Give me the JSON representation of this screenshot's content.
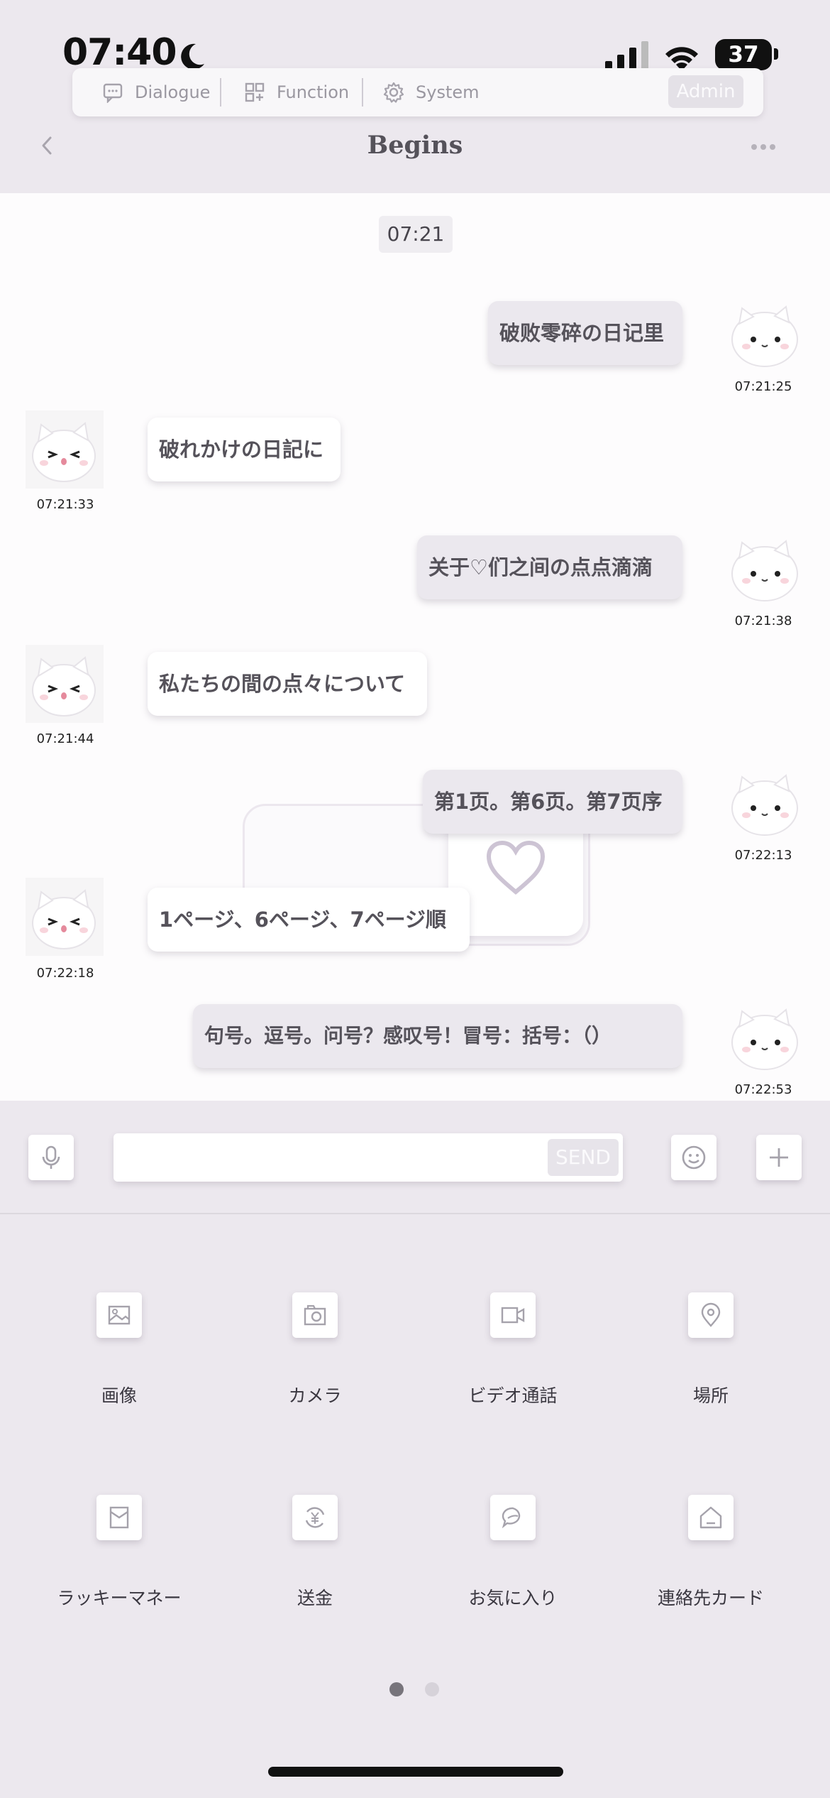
{
  "status_bar": {
    "time": "07:40",
    "battery": "37"
  },
  "menu": {
    "dialogue": "Dialogue",
    "function": "Function",
    "system": "System",
    "admin": "Admin"
  },
  "header": {
    "title": "Begins"
  },
  "chat": {
    "time_divider": "07:21",
    "messages": [
      {
        "side": "sent",
        "text": "破败零碎の日记里",
        "time": "07:21:25"
      },
      {
        "side": "recv",
        "text": "破れかけの日記に",
        "time": "07:21:33"
      },
      {
        "side": "sent",
        "text": "关于♡们之间の点点滴滴",
        "time": "07:21:38"
      },
      {
        "side": "recv",
        "text": "私たちの間の点々について",
        "time": "07:21:44"
      },
      {
        "side": "sent",
        "text": "第1页。第6页。第7页序",
        "time": "07:22:13"
      },
      {
        "side": "recv",
        "text": "1ページ、6ページ、7ページ順",
        "time": "07:22:18"
      },
      {
        "side": "sent",
        "text": "句号。逗号。问号？感叹号！冒号：括号：（）",
        "time": "07:22:53"
      }
    ]
  },
  "input": {
    "placeholder": "",
    "send": "SEND"
  },
  "functions": [
    {
      "label": "画像",
      "icon": "image-icon"
    },
    {
      "label": "カメラ",
      "icon": "camera-icon"
    },
    {
      "label": "ビデオ通話",
      "icon": "video-call-icon"
    },
    {
      "label": "場所",
      "icon": "location-pin-icon"
    },
    {
      "label": "ラッキーマネー",
      "icon": "red-envelope-icon"
    },
    {
      "label": "送金",
      "icon": "yen-transfer-icon"
    },
    {
      "label": "お気に入り",
      "icon": "favorite-chat-icon"
    },
    {
      "label": "連絡先カード",
      "icon": "home-card-icon"
    }
  ],
  "pager": {
    "active_page": 1,
    "total_pages": 2
  },
  "colors": {
    "background": "#ece8ee",
    "chat_background": "#fdfcfd",
    "sent_bubble": "#ebe8ee",
    "recv_bubble": "#ffffff",
    "heart": "#cdc4d4"
  }
}
